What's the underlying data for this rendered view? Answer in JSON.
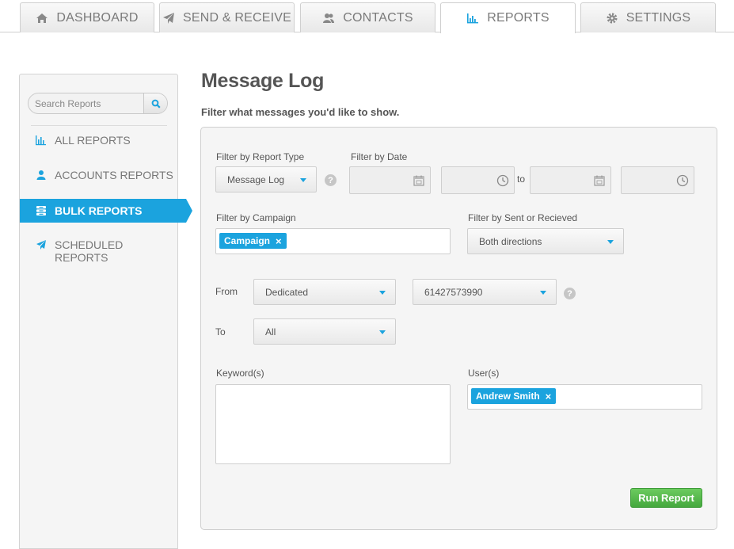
{
  "tabs": [
    {
      "label": "DASHBOARD",
      "icon": "home-icon"
    },
    {
      "label": "SEND & RECEIVE",
      "icon": "paper-plane-icon"
    },
    {
      "label": "CONTACTS",
      "icon": "users-icon"
    },
    {
      "label": "REPORTS",
      "icon": "bar-chart-icon",
      "active": true
    },
    {
      "label": "SETTINGS",
      "icon": "gear-icon"
    }
  ],
  "sidebar": {
    "search": {
      "placeholder": "Search Reports",
      "value": ""
    },
    "items": [
      {
        "label": "ALL REPORTS",
        "icon": "bar-chart-icon"
      },
      {
        "label": "ACCOUNTS REPORTS",
        "icon": "user-icon"
      },
      {
        "label": "BULK REPORTS",
        "icon": "stack-icon",
        "active": true
      },
      {
        "label": "SCHEDULED REPORTS",
        "icon": "paper-plane-icon"
      }
    ]
  },
  "main": {
    "title": "Message Log",
    "subtitle": "Filter what messages you'd like to show.",
    "filters": {
      "report_type": {
        "label": "Filter by Report Type",
        "value": "Message Log"
      },
      "date": {
        "label": "Filter by Date",
        "to_label": "to",
        "start_date": "",
        "start_time": "",
        "end_date": "",
        "end_time": ""
      },
      "campaign": {
        "label": "Filter by Campaign",
        "tags": [
          "Campaign"
        ]
      },
      "direction": {
        "label": "Filter by Sent or Recieved",
        "value": "Both directions"
      },
      "from": {
        "label": "From",
        "type_value": "Dedicated",
        "number_value": "61427573990"
      },
      "to": {
        "label": "To",
        "value": "All"
      },
      "keywords": {
        "label": "Keyword(s)",
        "value": ""
      },
      "users": {
        "label": "User(s)",
        "tags": [
          "Andrew Smith"
        ]
      }
    },
    "help_glyph": "?",
    "remove_glyph": "×",
    "run_button": "Run Report"
  },
  "colors": {
    "accent": "#1ba3de",
    "run_button": "#4caf44",
    "panel_bg": "#f5f5f5"
  }
}
